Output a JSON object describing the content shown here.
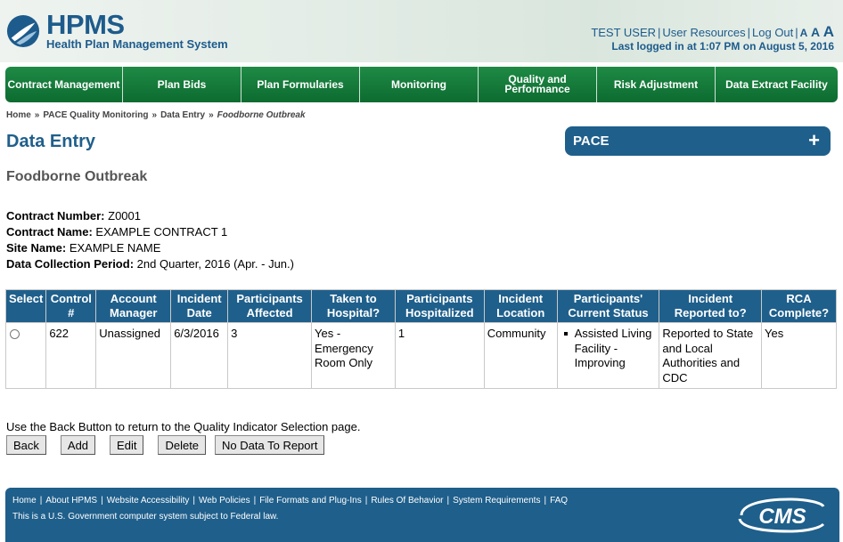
{
  "header": {
    "app_name": "HPMS",
    "app_subtitle": "Health Plan Management System",
    "user": "TEST USER",
    "user_resources": "User Resources",
    "log_out": "Log Out",
    "font_a_small": "A",
    "font_a_medium": "A",
    "font_a_large": "A",
    "last_login": "Last logged in at 1:07 PM on August 5, 2016"
  },
  "nav": {
    "items": [
      {
        "label": "Contract Management"
      },
      {
        "label": "Plan Bids"
      },
      {
        "label": "Plan Formularies"
      },
      {
        "label": "Monitoring"
      },
      {
        "label": "Quality and Performance"
      },
      {
        "label": "Risk Adjustment"
      },
      {
        "label": "Data Extract Facility"
      }
    ]
  },
  "breadcrumb": {
    "items": [
      "Home",
      "PACE Quality Monitoring",
      "Data Entry"
    ],
    "current": "Foodborne Outbreak",
    "separator": "»"
  },
  "page": {
    "title": "Data Entry",
    "pace_label": "PACE",
    "pace_toggle": "+",
    "subtitle": "Foodborne Outbreak"
  },
  "contract": {
    "number_label": "Contract Number:",
    "number": "Z0001",
    "name_label": "Contract Name:",
    "name": "EXAMPLE CONTRACT 1",
    "site_label": "Site Name:",
    "site": "EXAMPLE NAME",
    "period_label": "Data Collection Period:",
    "period": "2nd Quarter, 2016 (Apr. - Jun.)"
  },
  "table": {
    "headers": [
      "Select",
      "Control #",
      "Account Manager",
      "Incident Date",
      "Participants Affected",
      "Taken to Hospital?",
      "Participants Hospitalized",
      "Incident Location",
      "Participants' Current Status",
      "Incident Reported to?",
      "RCA Complete?"
    ],
    "rows": [
      {
        "control": "622",
        "account_manager": "Unassigned",
        "incident_date": "6/3/2016",
        "participants_affected": "3",
        "taken_to_hospital": "Yes - Emergency Room Only",
        "participants_hospitalized": "1",
        "incident_location": "Community",
        "current_status": [
          "Assisted Living Facility - Improving"
        ],
        "reported_to": "Reported to State and Local Authorities and CDC",
        "rca_complete": "Yes"
      }
    ]
  },
  "actions": {
    "back_note": "Use the Back Button to return to the Quality Indicator Selection page.",
    "back": "Back",
    "add": "Add",
    "edit": "Edit",
    "delete": "Delete",
    "no_data": "No Data To Report"
  },
  "footer": {
    "links": [
      "Home",
      "About HPMS",
      "Website Accessibility",
      "Web Policies",
      "File Formats and Plug-Ins",
      "Rules Of Behavior",
      "System Requirements",
      "FAQ"
    ],
    "note": "This is a U.S. Government computer system subject to Federal law.",
    "logo_text": "CMS"
  },
  "colors": {
    "brand_blue": "#1f5f8b",
    "nav_green": "#0d6b30"
  }
}
